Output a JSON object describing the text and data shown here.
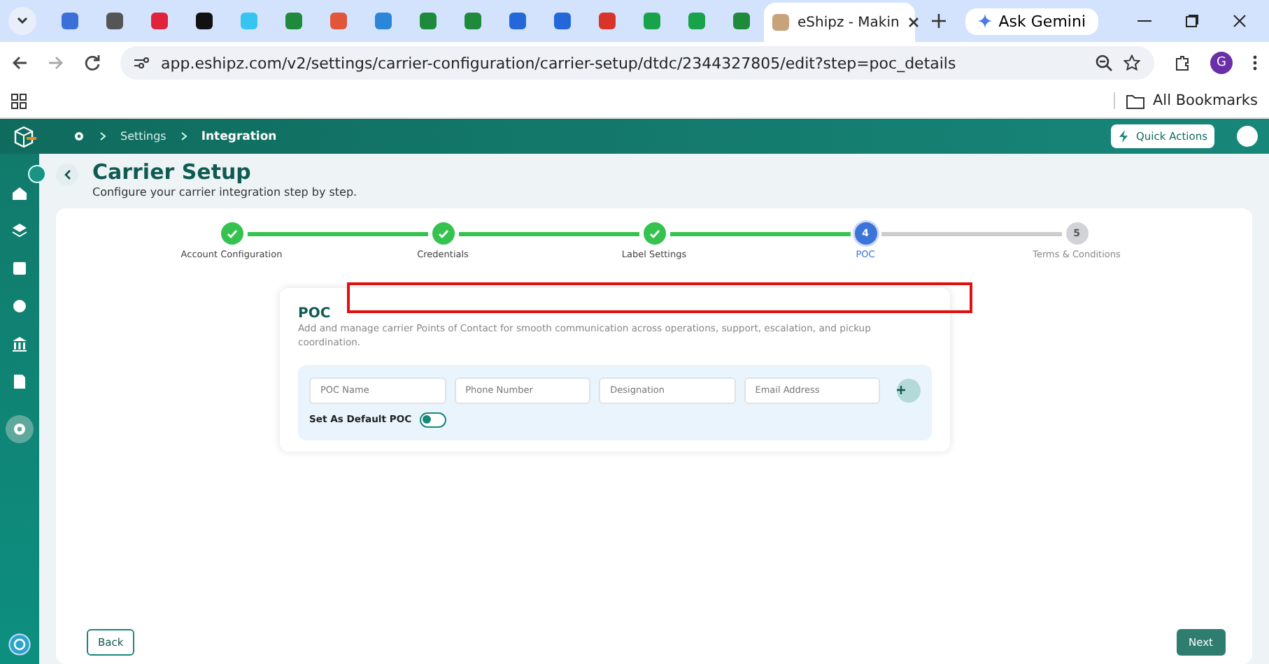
{
  "browser": {
    "tabs": [
      {
        "selected": false,
        "color": "#3b6fd8"
      },
      {
        "selected": false,
        "color": "#555555"
      },
      {
        "selected": false,
        "color": "#e0233a"
      },
      {
        "selected": false,
        "color": "#111111"
      },
      {
        "selected": false,
        "color": "#36c5f0"
      },
      {
        "selected": false,
        "color": "#1f8a3c"
      },
      {
        "selected": false,
        "color": "#e2553b"
      },
      {
        "selected": false,
        "color": "#2a86d8"
      },
      {
        "selected": false,
        "color": "#1f8a3c"
      },
      {
        "selected": false,
        "color": "#1f8a3c"
      },
      {
        "selected": false,
        "color": "#2467d8"
      },
      {
        "selected": false,
        "color": "#2467d8"
      },
      {
        "selected": false,
        "color": "#d8342a"
      },
      {
        "selected": false,
        "color": "#18a34a"
      },
      {
        "selected": false,
        "color": "#18a34a"
      },
      {
        "selected": false,
        "color": "#1f8a3c"
      },
      {
        "selected": true,
        "color": "#c8a27a",
        "title": "eShipz - Makin"
      }
    ],
    "gemini": "Ask Gemini",
    "url": "app.eshipz.com/v2/settings/carrier-configuration/carrier-setup/dtdc/2344327805/edit?step=poc_details",
    "profile": "G",
    "bookmarks": "All Bookmarks"
  },
  "header": {
    "breadcrumb": [
      "Settings",
      "Integration"
    ],
    "quick_actions": "Quick Actions"
  },
  "sidebar": {
    "items": [
      {
        "kind": "home",
        "selected": false
      },
      {
        "kind": "layers",
        "selected": false
      },
      {
        "kind": "box",
        "selected": false
      },
      {
        "kind": "dot",
        "selected": false
      },
      {
        "kind": "bank",
        "selected": false
      },
      {
        "kind": "doc",
        "selected": false
      },
      {
        "kind": "gear",
        "selected": true
      }
    ]
  },
  "page": {
    "title": "Carrier Setup",
    "subtitle": "Configure your carrier integration step by step."
  },
  "steps": [
    {
      "label": "Account Configuration",
      "completed": true,
      "selected": false
    },
    {
      "label": "Credentials",
      "completed": true,
      "selected": false
    },
    {
      "label": "Label Settings",
      "completed": true,
      "selected": false
    },
    {
      "label": "POC",
      "completed": false,
      "selected": true,
      "number": "4"
    },
    {
      "label": "Terms & Conditions",
      "completed": false,
      "selected": false,
      "number": "5"
    }
  ],
  "poc": {
    "title": "POC",
    "description": "Add and manage carrier Points of Contact for smooth communication across operations, support, escalation, and pickup coordination.",
    "fields": [
      {
        "placeholder": "POC Name"
      },
      {
        "placeholder": "Phone Number"
      },
      {
        "placeholder": "Designation"
      },
      {
        "placeholder": "Email Address"
      }
    ],
    "default_label": "Set As Default POC",
    "default_on": false
  },
  "buttons": {
    "back": "Back",
    "next": "Next"
  }
}
